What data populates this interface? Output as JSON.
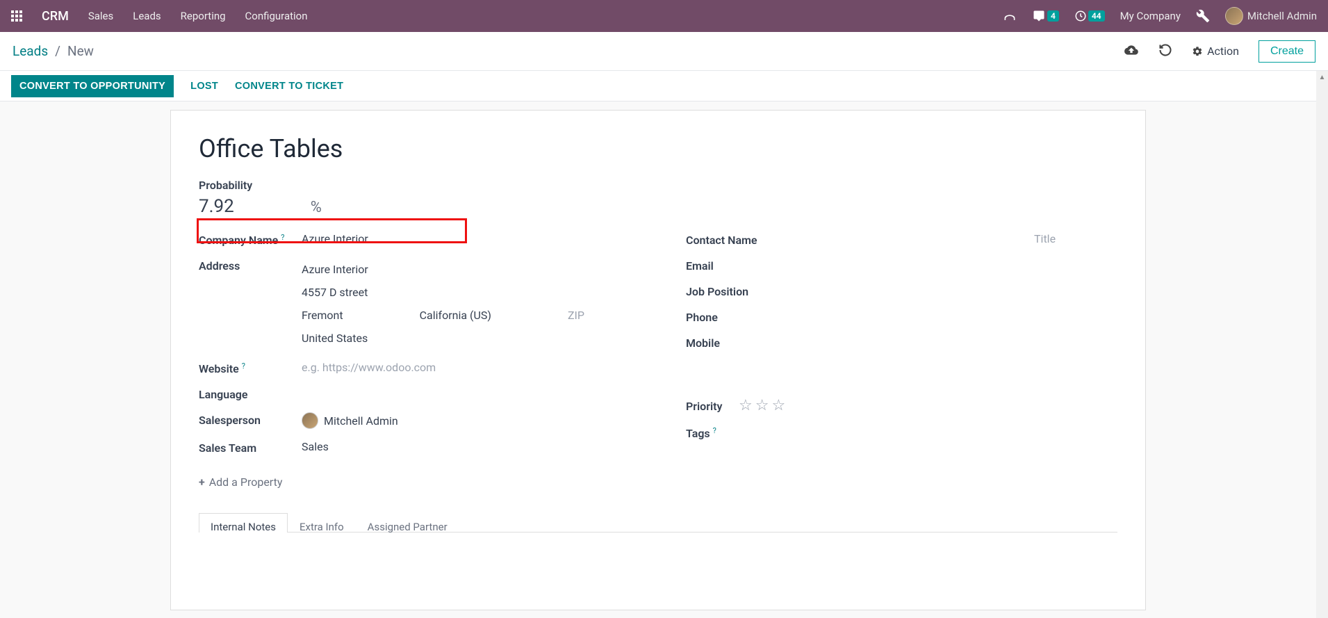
{
  "navbar": {
    "brand": "CRM",
    "items": [
      "Sales",
      "Leads",
      "Reporting",
      "Configuration"
    ],
    "msg_badge": "4",
    "activity_badge": "44",
    "company": "My Company",
    "user": "Mitchell Admin"
  },
  "controlbar": {
    "crumb_root": "Leads",
    "crumb_sep": "/",
    "crumb_current": "New",
    "action_label": "Action",
    "create_label": "Create"
  },
  "statusbar": {
    "convert_opp": "CONVERT TO OPPORTUNITY",
    "lost": "LOST",
    "convert_ticket": "CONVERT TO TICKET"
  },
  "record": {
    "title": "Office Tables",
    "probability_label": "Probability",
    "probability_value": "7.92",
    "probability_pct": "%",
    "left": {
      "company_name_label": "Company Name",
      "company_name_value": "Azure Interior",
      "address_label": "Address",
      "address": {
        "line1": "Azure Interior",
        "line2": "4557 D street",
        "city": "Fremont",
        "state": "California (US)",
        "zip_placeholder": "ZIP",
        "country": "United States"
      },
      "website_label": "Website",
      "website_placeholder": "e.g. https://www.odoo.com",
      "language_label": "Language",
      "salesperson_label": "Salesperson",
      "salesperson_value": "Mitchell Admin",
      "salesteam_label": "Sales Team",
      "salesteam_value": "Sales"
    },
    "right": {
      "contact_name_label": "Contact Name",
      "title_placeholder": "Title",
      "email_label": "Email",
      "job_position_label": "Job Position",
      "phone_label": "Phone",
      "mobile_label": "Mobile",
      "priority_label": "Priority",
      "tags_label": "Tags"
    },
    "add_property": "Add a Property",
    "tabs": [
      "Internal Notes",
      "Extra Info",
      "Assigned Partner"
    ]
  }
}
